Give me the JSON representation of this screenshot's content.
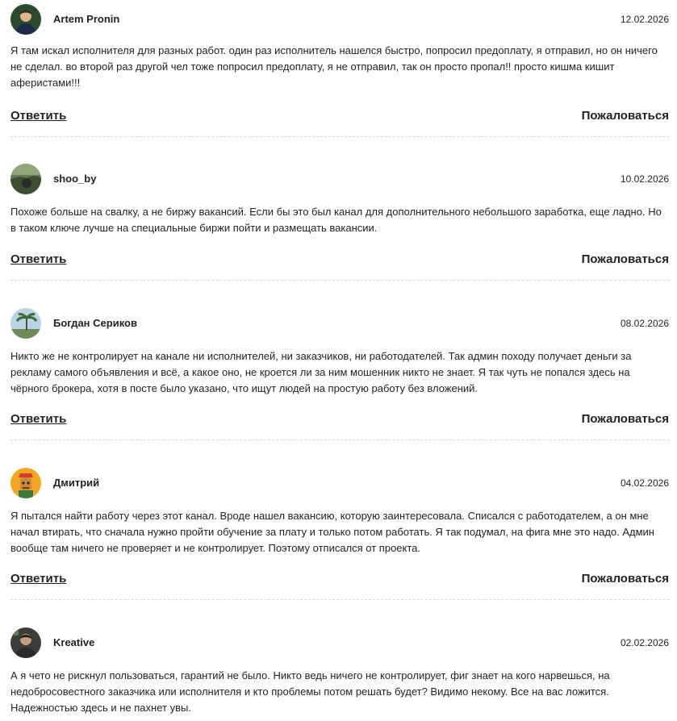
{
  "comments": [
    {
      "author": "Artem Pronin",
      "date": "12.02.2026",
      "avatar_icon": "avatar-photo-icon",
      "text": "Я там искал исполнителя для разных работ. один раз исполнитель нашелся быстро, попросил предоплату, я отправил, но он ничего не сделал. во второй раз другой чел тоже попросил предоплату, я не отправил, так он просто пропал!! просто кишма кишит аферистами!!!",
      "reply_label": "Ответить",
      "report_label": "Пожаловаться"
    },
    {
      "author": "shoo_by",
      "date": "10.02.2026",
      "avatar_icon": "avatar-photo-icon",
      "text": "Похоже больше на свалку, а не биржу вакансий. Если бы это был канал для дополнительного небольшого заработка, еще ладно. Но в таком ключе лучше на специальные биржи пойти и размещать вакансии.",
      "reply_label": "Ответить",
      "report_label": "Пожаловаться"
    },
    {
      "author": "Богдан Сериков",
      "date": "08.02.2026",
      "avatar_icon": "avatar-photo-icon",
      "text": "Никто же не контролирует на канале ни исполнителей, ни заказчиков, ни работодателей. Так админ походу получает деньги за рекламу самого объявления и всё, а какое оно, не кроется ли за ним мошенник никто не знает. Я так чуть не попался здесь на чёрного брокера, хотя в посте было указано, что ищут людей на простую работу без вложений.",
      "reply_label": "Ответить",
      "report_label": "Пожаловаться"
    },
    {
      "author": "Дмитрий",
      "date": "04.02.2026",
      "avatar_icon": "avatar-cartoon-icon",
      "text": "Я пытался найти работу через этот канал. Вроде нашел вакансию, которую заинтересовала. Списался с работодателем, а он мне начал втирать, что сначала нужно пройти обучение за плату и только потом работать. Я так подумал, на фига мне это надо. Админ вообще там ничего не проверяет и не контролирует. Поэтому отписался от проекта.",
      "reply_label": "Ответить",
      "report_label": "Пожаловаться"
    },
    {
      "author": "Kreative",
      "date": "02.02.2026",
      "avatar_icon": "avatar-photo-icon",
      "text": "А я чето не рискнул пользоваться, гарантий не было. Никто ведь ничего не контролирует, фиг знает на кого нарвешься, на недобросовестного заказчика или исполнителя и кто проблемы потом решать будет? Видимо некому. Все на вас ложится. Надежностью здесь и не пахнет увы.",
      "reply_label": "Ответить",
      "report_label": "Пожаловаться"
    }
  ]
}
